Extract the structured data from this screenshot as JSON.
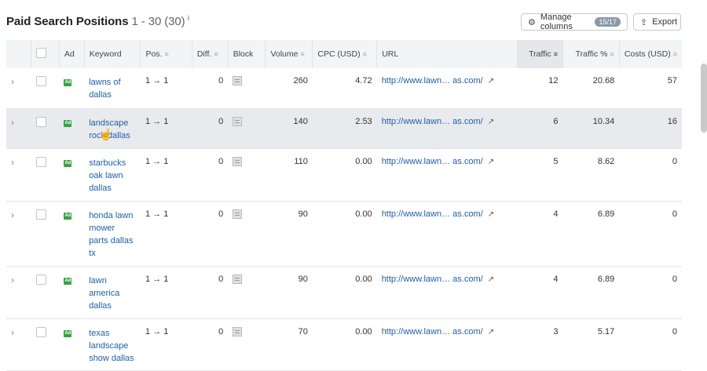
{
  "header": {
    "title": "Paid Search Positions",
    "range": "1 - 30 (30)",
    "info": "i",
    "manage_columns_label": "Manage columns",
    "manage_columns_badge": "15/17",
    "export_label": "Export"
  },
  "columns": [
    "Ad",
    "Keyword",
    "Pos.",
    "Diff.",
    "Block",
    "Volume",
    "CPC (USD)",
    "URL",
    "Traffic",
    "Traffic %",
    "Costs (USD)"
  ],
  "rows": [
    {
      "keyword": "lawns of dallas",
      "pos_from": "1",
      "pos_to": "1",
      "diff": "0",
      "volume": "260",
      "cpc": "4.72",
      "url": "http://www.lawn… as.com/",
      "traffic": "12",
      "traffic_pct": "20.68",
      "costs": "57"
    },
    {
      "keyword": "landscape rock dallas",
      "pos_from": "1",
      "pos_to": "1",
      "diff": "0",
      "volume": "140",
      "cpc": "2.53",
      "url": "http://www.lawn… as.com/",
      "traffic": "6",
      "traffic_pct": "10.34",
      "costs": "16"
    },
    {
      "keyword": "starbucks oak lawn dallas",
      "pos_from": "1",
      "pos_to": "1",
      "diff": "0",
      "volume": "110",
      "cpc": "0.00",
      "url": "http://www.lawn… as.com/",
      "traffic": "5",
      "traffic_pct": "8.62",
      "costs": "0"
    },
    {
      "keyword": "honda lawn mower parts dallas tx",
      "pos_from": "1",
      "pos_to": "1",
      "diff": "0",
      "volume": "90",
      "cpc": "0.00",
      "url": "http://www.lawn… as.com/",
      "traffic": "4",
      "traffic_pct": "6.89",
      "costs": "0"
    },
    {
      "keyword": "lawn america dallas",
      "pos_from": "1",
      "pos_to": "1",
      "diff": "0",
      "volume": "90",
      "cpc": "0.00",
      "url": "http://www.lawn… as.com/",
      "traffic": "4",
      "traffic_pct": "6.89",
      "costs": "0"
    },
    {
      "keyword": "texas landscape show dallas",
      "pos_from": "1",
      "pos_to": "1",
      "diff": "0",
      "volume": "70",
      "cpc": "0.00",
      "url": "http://www.lawn… as.com/",
      "traffic": "3",
      "traffic_pct": "5.17",
      "costs": "0"
    }
  ]
}
